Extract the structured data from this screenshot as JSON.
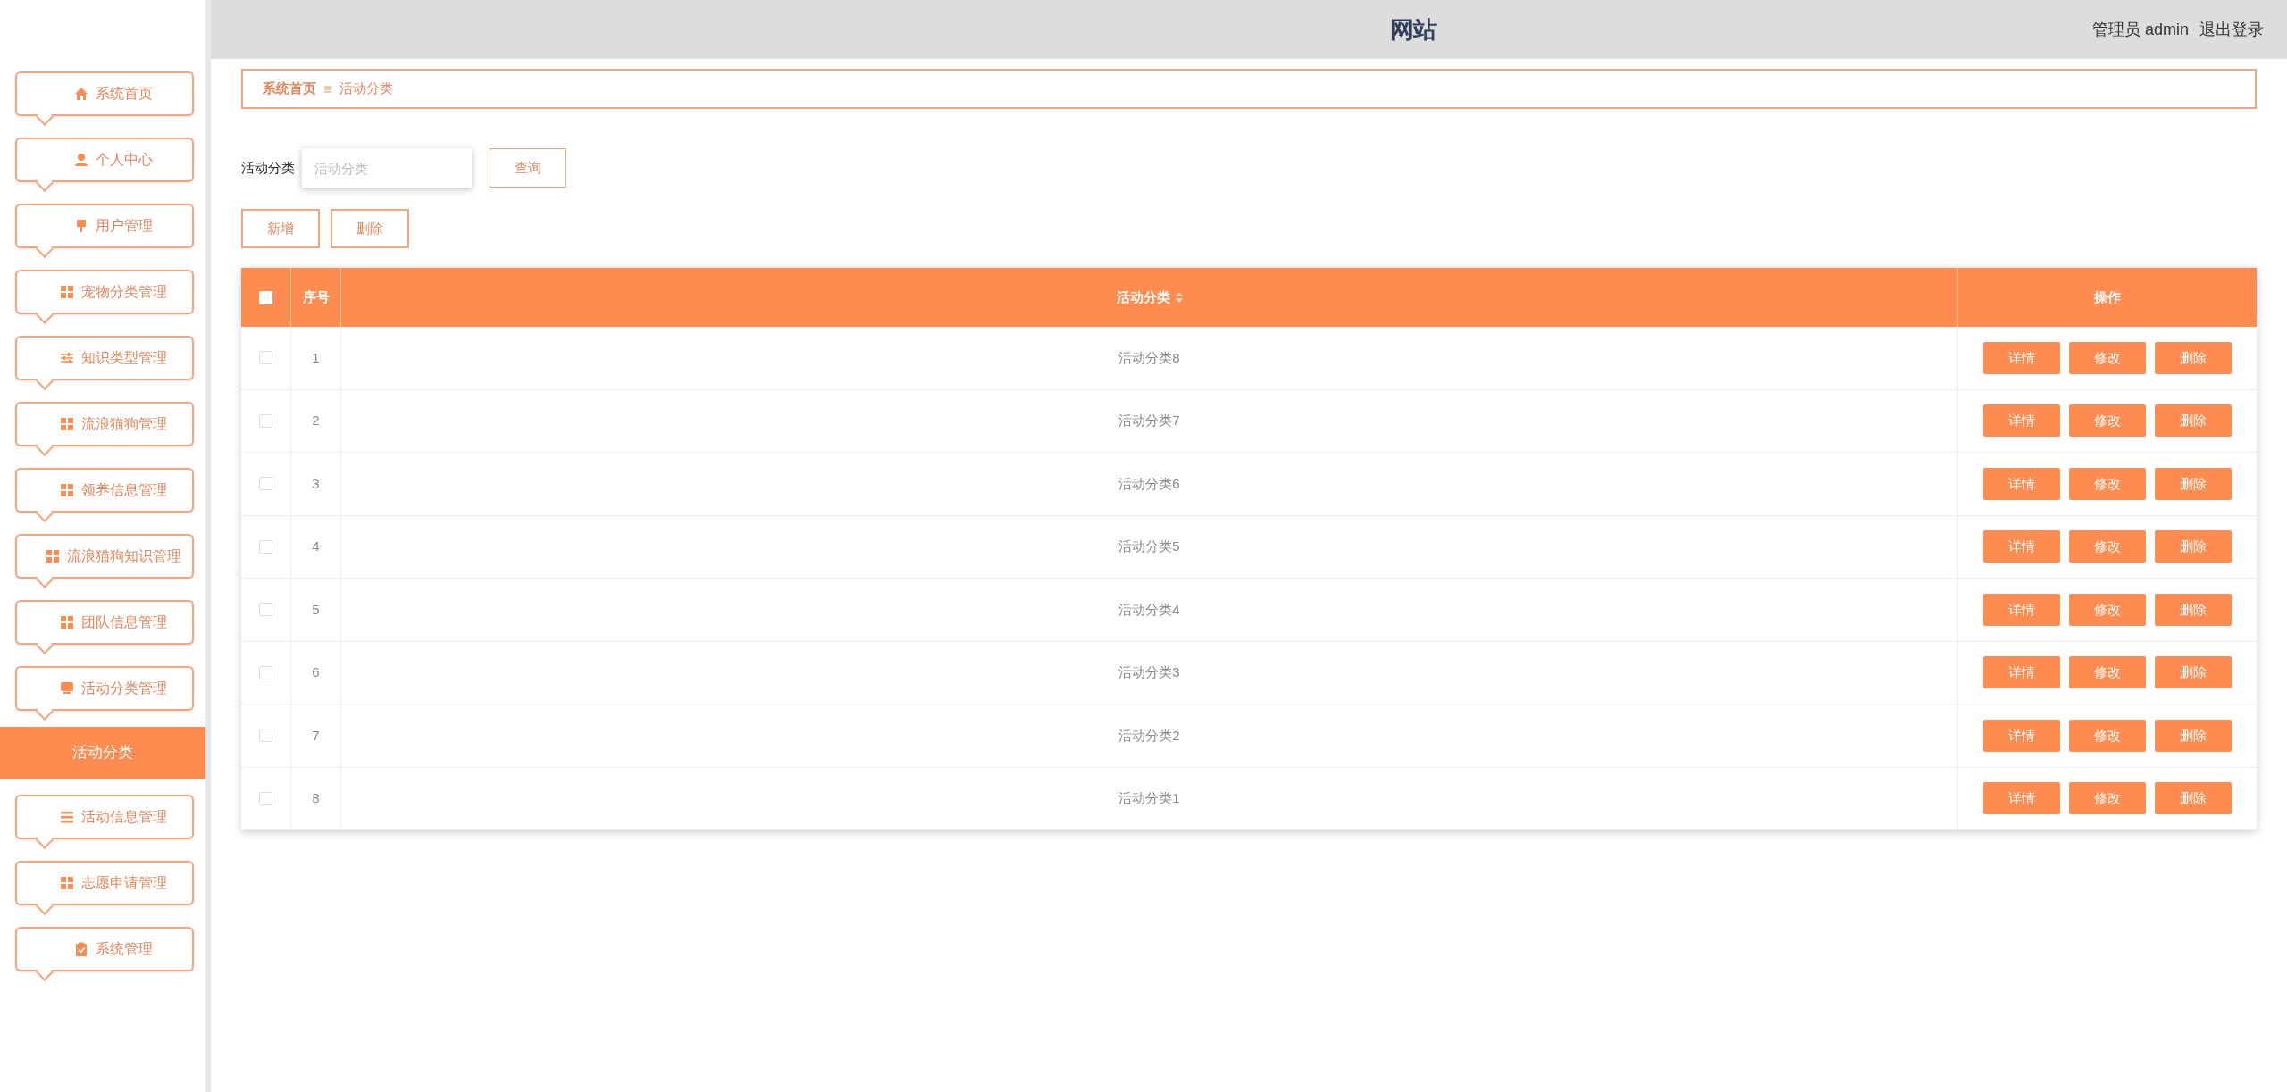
{
  "header": {
    "title": "网站",
    "user": "管理员 admin",
    "logout": "退出登录"
  },
  "sidebar": {
    "items": [
      {
        "label": "系统首页",
        "selected": false
      },
      {
        "label": "个人中心",
        "selected": false
      },
      {
        "label": "用户管理",
        "selected": false
      },
      {
        "label": "宠物分类管理",
        "selected": false
      },
      {
        "label": "知识类型管理",
        "selected": false
      },
      {
        "label": "流浪猫狗管理",
        "selected": false
      },
      {
        "label": "领养信息管理",
        "selected": false
      },
      {
        "label": "流浪猫狗知识管理",
        "selected": false
      },
      {
        "label": "团队信息管理",
        "selected": false
      },
      {
        "label": "活动分类管理",
        "selected": false,
        "children": [
          {
            "label": "活动分类",
            "selected": true
          }
        ]
      },
      {
        "label": "活动信息管理",
        "selected": false
      },
      {
        "label": "志愿申请管理",
        "selected": false
      },
      {
        "label": "系统管理",
        "selected": false
      }
    ]
  },
  "breadcrumb": [
    "系统首页",
    "活动分类"
  ],
  "search": {
    "label": "活动分类",
    "placeholder": "活动分类",
    "button": "查询"
  },
  "actions": [
    "新增",
    "删除"
  ],
  "table": {
    "columns": [
      "序号",
      "活动分类",
      "操作"
    ],
    "header_checked": false,
    "rows": [
      {
        "index": "1",
        "category": "活动分类8",
        "checked": false,
        "actions": [
          "详情",
          "修改",
          "删除"
        ]
      },
      {
        "index": "2",
        "category": "活动分类7",
        "checked": false,
        "actions": [
          "详情",
          "修改",
          "删除"
        ]
      },
      {
        "index": "3",
        "category": "活动分类6",
        "checked": false,
        "actions": [
          "详情",
          "修改",
          "删除"
        ]
      },
      {
        "index": "4",
        "category": "活动分类5",
        "checked": false,
        "actions": [
          "详情",
          "修改",
          "删除"
        ]
      },
      {
        "index": "5",
        "category": "活动分类4",
        "checked": false,
        "actions": [
          "详情",
          "修改",
          "删除"
        ]
      },
      {
        "index": "6",
        "category": "活动分类3",
        "checked": false,
        "actions": [
          "详情",
          "修改",
          "删除"
        ]
      },
      {
        "index": "7",
        "category": "活动分类2",
        "checked": false,
        "actions": [
          "详情",
          "修改",
          "删除"
        ]
      },
      {
        "index": "8",
        "category": "活动分类1",
        "checked": false,
        "actions": [
          "详情",
          "修改",
          "删除"
        ]
      }
    ]
  }
}
